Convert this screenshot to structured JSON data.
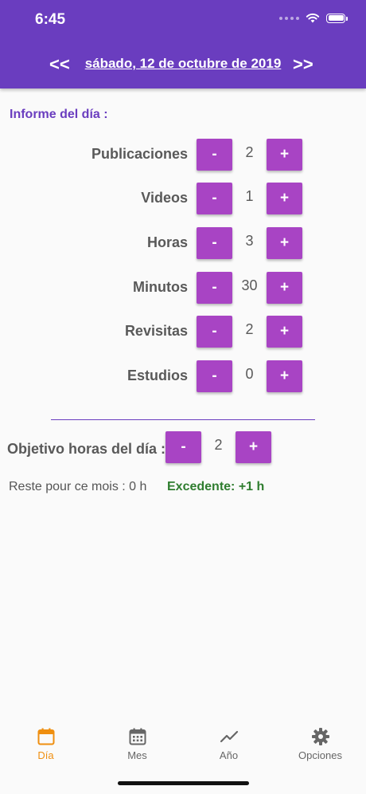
{
  "status_bar": {
    "time": "6:45"
  },
  "header": {
    "prev_label": "<<",
    "date": "sábado, 12 de octubre de 2019",
    "next_label": ">>"
  },
  "report": {
    "title": "Informe del día :",
    "minus_label": "-",
    "plus_label": "+",
    "rows": [
      {
        "label": "Publicaciones",
        "value": "2"
      },
      {
        "label": "Videos",
        "value": "1"
      },
      {
        "label": "Horas",
        "value": "3"
      },
      {
        "label": "Minutos",
        "value": "30"
      },
      {
        "label": "Revisitas",
        "value": "2"
      },
      {
        "label": "Estudios",
        "value": "0"
      }
    ]
  },
  "goal": {
    "label": "Objetivo horas del día :",
    "value": "2",
    "minus_label": "-",
    "plus_label": "+"
  },
  "summary": {
    "remaining": "Reste pour ce mois : 0 h",
    "excess": "Excedente: +1 h"
  },
  "tabs": [
    {
      "label": "Día",
      "icon": "calendar-today-icon",
      "active": true
    },
    {
      "label": "Mes",
      "icon": "calendar-month-icon",
      "active": false
    },
    {
      "label": "Año",
      "icon": "trending-icon",
      "active": false
    },
    {
      "label": "Opciones",
      "icon": "gear-icon",
      "active": false
    }
  ],
  "colors": {
    "header": "#6a3dbf",
    "button": "#a844c4",
    "active_tab": "#ef8f10",
    "excess": "#2f7d2f"
  }
}
